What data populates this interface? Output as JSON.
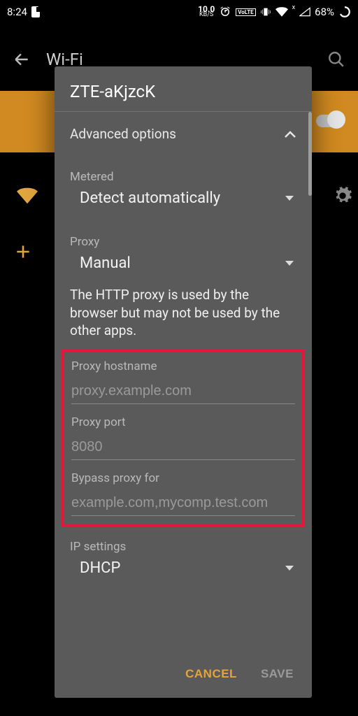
{
  "status": {
    "time": "8:24",
    "speed_value": "10.0",
    "speed_unit": "KB/S",
    "volte": "VoLTE",
    "battery": "68%"
  },
  "behind": {
    "title": "Wi-Fi"
  },
  "dialog": {
    "title": "ZTE-aKjzcK",
    "advanced_label": "Advanced options",
    "metered": {
      "label": "Metered",
      "value": "Detect automatically"
    },
    "proxy": {
      "label": "Proxy",
      "value": "Manual"
    },
    "help": "The HTTP proxy is used by the browser but may not be used by the other apps.",
    "fields": {
      "hostname": {
        "label": "Proxy hostname",
        "placeholder": "proxy.example.com"
      },
      "port": {
        "label": "Proxy port",
        "placeholder": "8080"
      },
      "bypass": {
        "label": "Bypass proxy for",
        "placeholder": "example.com,mycomp.test.com"
      }
    },
    "ip": {
      "label": "IP settings",
      "value": "DHCP"
    },
    "actions": {
      "cancel": "CANCEL",
      "save": "SAVE"
    }
  }
}
